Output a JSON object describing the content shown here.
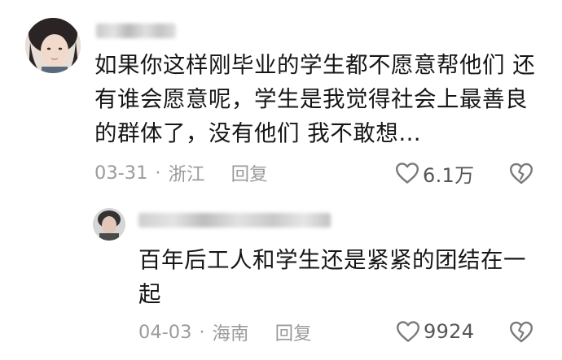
{
  "main_comment": {
    "text": "如果你这样刚毕业的学生都不愿意帮他们 还\n有谁会愿意呢，学生是我觉得社会上最善良\n的群体了，没有他们 我不敢想…",
    "date": "03-31",
    "separator": "·",
    "location": "浙江",
    "reply_label": "回复",
    "like_count": "6.1万",
    "icons": {
      "like": "heart-outline-icon",
      "dislike": "broken-heart-icon"
    }
  },
  "reply_comment": {
    "text": "百年后工人和学生还是紧紧的团结在一\n起",
    "date": "04-03",
    "separator": "·",
    "location": "海南",
    "reply_label": "回复",
    "like_count": "9924",
    "icons": {
      "like": "heart-outline-icon",
      "dislike": "broken-heart-icon"
    }
  },
  "colors": {
    "text": "#161616",
    "meta": "#9b9b9b",
    "icon": "#7a7a7a"
  }
}
